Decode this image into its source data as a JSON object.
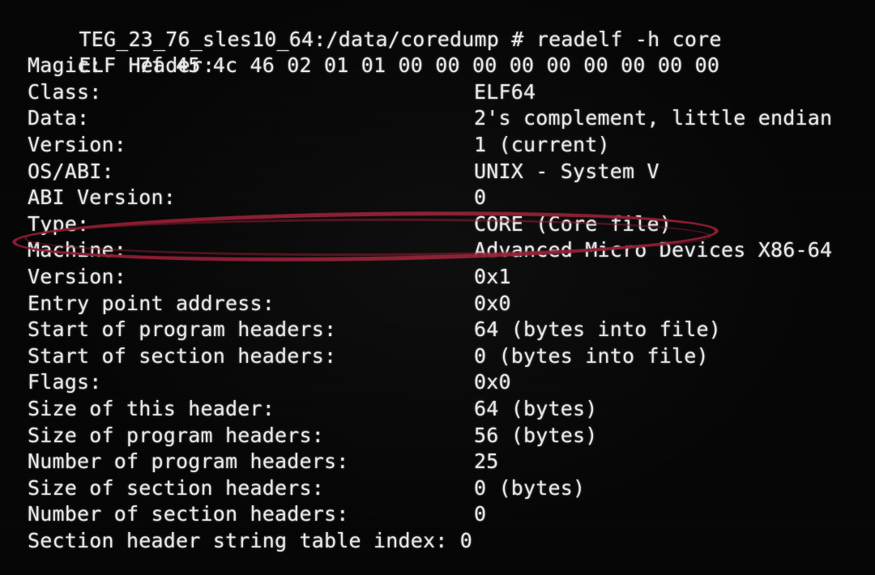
{
  "terminal": {
    "prompt": "TEG_23_76_sles10_64:/data/coredump # readelf -h core",
    "section_title": "ELF Header:",
    "fields": [
      {
        "label": "Magic:   ",
        "value": "7f 45 4c 46 02 01 01 00 00 00 00 00 00 00 00 00",
        "inline": true
      },
      {
        "label": "Class:",
        "value": "ELF64"
      },
      {
        "label": "Data:",
        "value": "2's complement, little endian"
      },
      {
        "label": "Version:",
        "value": "1 (current)"
      },
      {
        "label": "OS/ABI:",
        "value": "UNIX - System V"
      },
      {
        "label": "ABI Version:",
        "value": "0"
      },
      {
        "label": "Type:",
        "value": "CORE (Core file)"
      },
      {
        "label": "Machine:",
        "value": "Advanced Micro Devices X86-64"
      },
      {
        "label": "Version:",
        "value": "0x1"
      },
      {
        "label": "Entry point address:",
        "value": "0x0"
      },
      {
        "label": "Start of program headers:",
        "value": "64 (bytes into file)"
      },
      {
        "label": "Start of section headers:",
        "value": "0 (bytes into file)"
      },
      {
        "label": "Flags:",
        "value": "0x0"
      },
      {
        "label": "Size of this header:",
        "value": "64 (bytes)"
      },
      {
        "label": "Size of program headers:",
        "value": "56 (bytes)"
      },
      {
        "label": "Number of program headers:",
        "value": "25"
      },
      {
        "label": "Size of section headers:",
        "value": "0 (bytes)"
      },
      {
        "label": "Number of section headers:",
        "value": "0"
      },
      {
        "label": "Section header string table index: 0",
        "value": "",
        "inline": true
      }
    ]
  },
  "annotation": {
    "target_label": "Type:",
    "target_value": "CORE (Core file)",
    "shape": "ellipse",
    "color": "#8e1b30"
  },
  "colors": {
    "background": "#050505",
    "foreground": "#e9e9e9",
    "annotation_red": "#8e1b30"
  }
}
